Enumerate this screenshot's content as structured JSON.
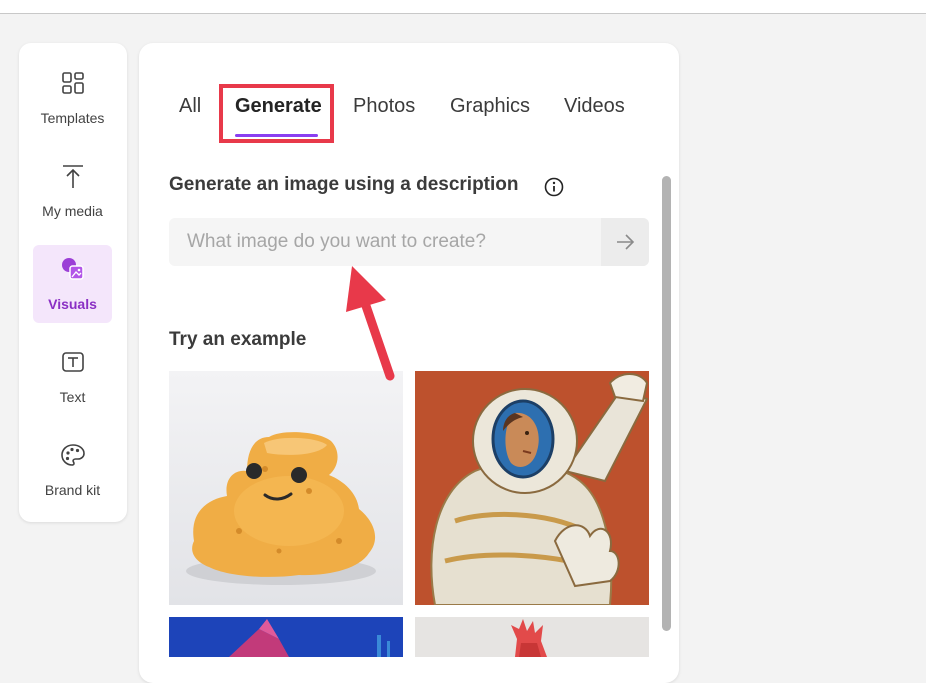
{
  "nav": {
    "items": [
      {
        "label": "Templates",
        "icon": "templates-icon"
      },
      {
        "label": "My media",
        "icon": "upload-icon"
      },
      {
        "label": "Visuals",
        "icon": "visuals-icon",
        "active": true
      },
      {
        "label": "Text",
        "icon": "text-icon"
      },
      {
        "label": "Brand kit",
        "icon": "palette-icon"
      }
    ]
  },
  "tabs": [
    {
      "label": "All"
    },
    {
      "label": "Generate",
      "active": true
    },
    {
      "label": "Photos"
    },
    {
      "label": "Graphics"
    },
    {
      "label": "Videos"
    }
  ],
  "generate": {
    "title": "Generate an image using a description",
    "placeholder": "What image do you want to create?",
    "send_icon": "arrow-right-icon"
  },
  "examples": {
    "title": "Try an example",
    "thumbnails": [
      "sponge-creature",
      "astronaut-painting",
      "blue-origami",
      "red-hand-sculpture"
    ]
  },
  "colors": {
    "accent": "#8a3ff0",
    "active_bg": "#f4e6fb",
    "active_text": "#8a2fc4",
    "annotation_red": "#e8394a"
  }
}
